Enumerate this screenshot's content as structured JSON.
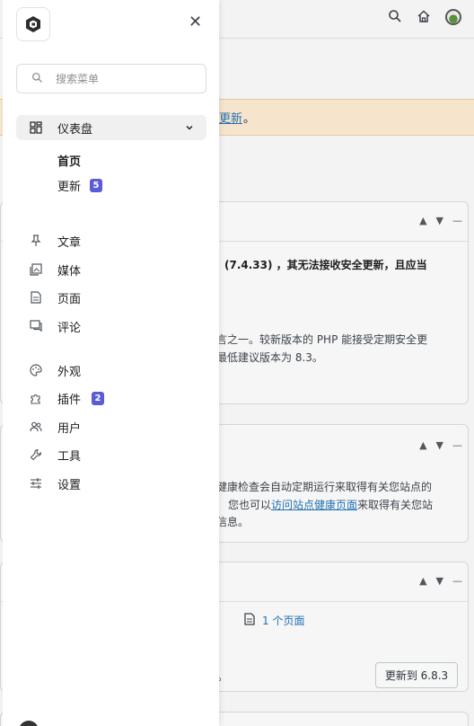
{
  "background": {
    "notice_link": "更新",
    "notice_dot": "。",
    "card1": {
      "bold_line": "(7.4.33) ，其无法接收安全更新，且应当",
      "line1": "言之一。较新版本的 PHP 能接受定期安全更",
      "line2": "最低建议版本为 8.3。"
    },
    "card2": {
      "line1": "健康检查会自动定期运行来取得有关您站点的",
      "line2_pre": "您也可以",
      "line2_link": "访问站点健康页面",
      "line2_post": "来取得有关您站",
      "line3": "信息。"
    },
    "card3": {
      "page_count": "1 个页面",
      "trailing": "。",
      "update_button": "更新到 6.8.3"
    }
  },
  "sidebar": {
    "search_placeholder": "搜索菜单",
    "dashboard": "仪表盘",
    "sub_home": "首页",
    "sub_updates": "更新",
    "updates_badge": "5",
    "items": [
      {
        "label": "文章"
      },
      {
        "label": "媒体"
      },
      {
        "label": "页面"
      },
      {
        "label": "评论"
      },
      {
        "label": "外观"
      },
      {
        "label": "插件",
        "badge": "2"
      },
      {
        "label": "用户"
      },
      {
        "label": "工具"
      },
      {
        "label": "设置"
      }
    ]
  },
  "colors": {
    "accent": "#5b5bd6",
    "link": "#2271b1",
    "notice_bg": "#f7e4cd"
  }
}
